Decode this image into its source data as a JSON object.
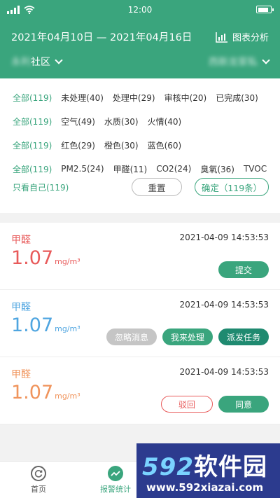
{
  "status": {
    "time": "12:00"
  },
  "header": {
    "date_range": "2021年04月10日 — 2021年04月16日",
    "chart_label": "图表分析",
    "community_blur": "永利",
    "community_suffix": "社区",
    "right_blur": "西新龙家私"
  },
  "filters": {
    "row1": [
      "全部(119)",
      "未处理(40)",
      "处理中(29)",
      "审核中(20)",
      "已完成(30)"
    ],
    "row2": [
      "全部(119)",
      "空气(49)",
      "水质(30)",
      "火情(40)"
    ],
    "row3": [
      "全部(119)",
      "红色(29)",
      "橙色(30)",
      "蓝色(60)"
    ],
    "row4": [
      "全部(119)",
      "PM2.5(24)",
      "甲醛(11)",
      "CO2(24)",
      "臭氧(36)",
      "TVOC"
    ],
    "only_mine": "只看自己(119)",
    "reset": "重置",
    "confirm": "确定（119条）"
  },
  "cards": [
    {
      "title": "甲醛",
      "time": "2021-04-09  14:53:53",
      "value": "1.07",
      "unit": "mg/m³",
      "buttons": [
        "提交"
      ]
    },
    {
      "title": "甲醛",
      "time": "2021-04-09  14:53:53",
      "value": "1.07",
      "unit": "mg/m³",
      "buttons": [
        "忽略消息",
        "我来处理",
        "派发任务"
      ]
    },
    {
      "title": "甲醛",
      "time": "2021-04-09  14:53:53",
      "value": "1.07",
      "unit": "mg/m³",
      "buttons": [
        "驳回",
        "同意"
      ]
    }
  ],
  "tabs": {
    "home": "首页",
    "alarm": "报警统计"
  },
  "watermark": {
    "brand_num": "592",
    "brand_text": "软件园",
    "url": "www.592xiazai.com"
  },
  "colors": {
    "primary": "#3aa57d",
    "red": "#e85a5a",
    "blue": "#4fa5e0",
    "orange": "#f0945c"
  }
}
